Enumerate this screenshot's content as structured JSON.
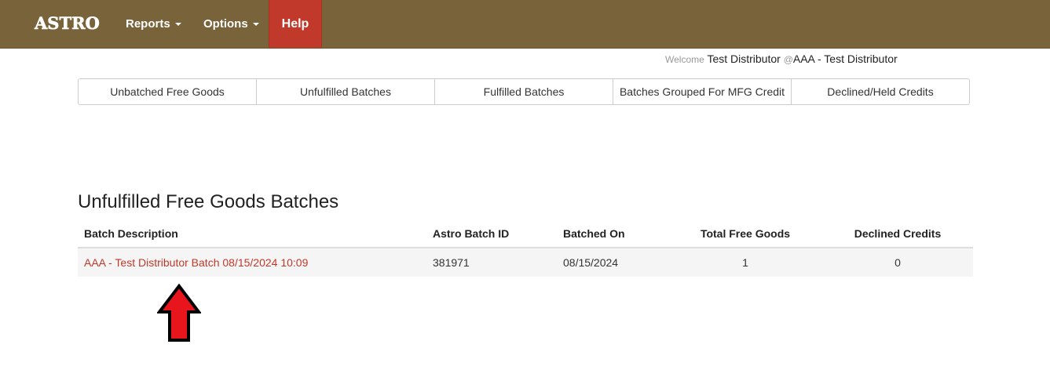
{
  "navbar": {
    "brand": "ASTRO",
    "menu": [
      {
        "label": "Reports"
      },
      {
        "label": "Options"
      }
    ],
    "help_label": "Help",
    "colors": {
      "bar": "#78633a",
      "help": "#c0392b"
    }
  },
  "welcome": {
    "prefix": "Welcome",
    "user": "Test Distributor",
    "at": "@",
    "org": "AAA - Test Distributor"
  },
  "tabs": [
    {
      "label": "Unbatched Free Goods"
    },
    {
      "label": "Unfulfilled Batches"
    },
    {
      "label": "Fulfilled Batches"
    },
    {
      "label": "Batches Grouped For MFG Credit"
    },
    {
      "label": "Declined/Held Credits"
    }
  ],
  "section": {
    "title": "Unfulfilled Free Goods Batches"
  },
  "table": {
    "columns": [
      "Batch Description",
      "Astro Batch ID",
      "Batched On",
      "Total Free Goods",
      "Declined Credits"
    ],
    "rows": [
      {
        "description": "AAA - Test Distributor Batch 08/15/2024 10:09",
        "batch_id": "381971",
        "batched_on": "08/15/2024",
        "total_free_goods": "1",
        "declined_credits": "0"
      }
    ]
  },
  "annotation": {
    "icon": "up-arrow-icon",
    "color": "#e8161c"
  }
}
